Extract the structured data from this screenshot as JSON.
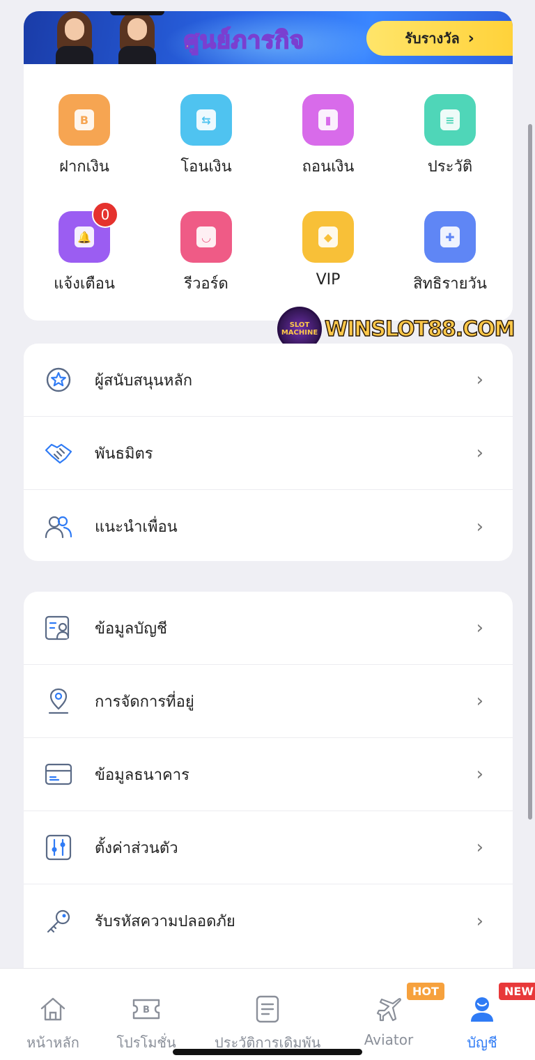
{
  "banner": {
    "title": "ศูนย์ภารกิจ",
    "reward_label": "รับรางวัล"
  },
  "quick_actions": [
    {
      "label": "ฝากเงิน",
      "color": "#f6a552",
      "icon": "money-bag-icon",
      "glyph": "B"
    },
    {
      "label": "โอนเงิน",
      "color": "#4fc3f0",
      "icon": "transfer-icon",
      "glyph": "⇆"
    },
    {
      "label": "ถอนเงิน",
      "color": "#d86bea",
      "icon": "withdraw-icon",
      "glyph": "▮"
    },
    {
      "label": "ประวัติ",
      "color": "#4fd6b8",
      "icon": "receipt-icon",
      "glyph": "≡"
    },
    {
      "label": "แจ้งเตือน",
      "color": "#9b5df2",
      "icon": "bell-icon",
      "glyph": "🔔",
      "badge": "0"
    },
    {
      "label": "รีวอร์ด",
      "color": "#ef5b86",
      "icon": "shopping-bag-icon",
      "glyph": "◡"
    },
    {
      "label": "VIP",
      "color": "#f8c038",
      "icon": "diamond-icon",
      "glyph": "◆"
    },
    {
      "label": "สิทธิรายวัน",
      "color": "#5f86f5",
      "icon": "gift-icon",
      "glyph": "✚"
    }
  ],
  "watermark": {
    "logo_text": "SLOT MACHINE",
    "text": "WINSLOT88.COM"
  },
  "menu_group1": [
    {
      "label": "ผู้สนับสนุนหลัก",
      "icon": "star-badge-icon"
    },
    {
      "label": "พันธมิตร",
      "icon": "handshake-icon"
    },
    {
      "label": "แนะนำเพื่อน",
      "icon": "users-icon"
    }
  ],
  "menu_group2": [
    {
      "label": "ข้อมูลบัญชี",
      "icon": "account-card-icon"
    },
    {
      "label": "การจัดการที่อยู่",
      "icon": "location-pin-icon"
    },
    {
      "label": "ข้อมูลธนาคาร",
      "icon": "bank-card-icon"
    },
    {
      "label": "ตั้งค่าส่วนตัว",
      "icon": "settings-sliders-icon"
    },
    {
      "label": "รับรหัสความปลอดภัย",
      "icon": "key-icon"
    }
  ],
  "chevron": "›",
  "tabs": [
    {
      "label": "หน้าหลัก",
      "icon": "home-icon"
    },
    {
      "label": "โปรโมชั่น",
      "icon": "ticket-icon"
    },
    {
      "label": "ประวัติการเดิมพัน",
      "icon": "document-icon"
    },
    {
      "label": "Aviator",
      "icon": "airplane-icon",
      "tag": "HOT"
    },
    {
      "label": "บัญชี",
      "icon": "user-icon",
      "tag": "NEW",
      "active": true
    }
  ]
}
